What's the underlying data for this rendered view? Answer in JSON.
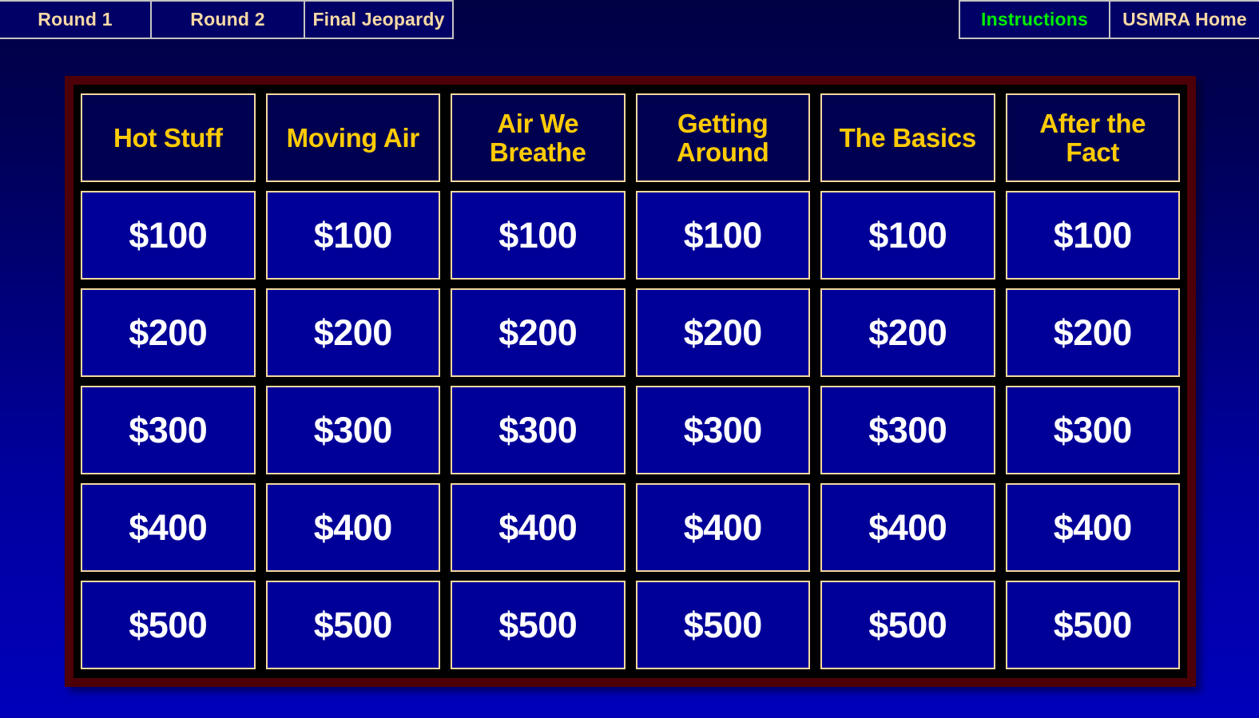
{
  "nav": {
    "left_buttons": [
      {
        "label": "Round 1",
        "name": "nav-round-1"
      },
      {
        "label": "Round 2",
        "name": "nav-round-2"
      },
      {
        "label": "Final Jeopardy",
        "name": "nav-final-jeopardy"
      }
    ],
    "right_buttons": [
      {
        "label": "Instructions",
        "name": "nav-instructions"
      },
      {
        "label": "USMRA Home",
        "name": "nav-usmra-home"
      }
    ]
  },
  "board": {
    "categories": [
      "Hot Stuff",
      "Moving Air",
      "Air We Breathe",
      "Getting Around",
      "The Basics",
      "After the Fact"
    ],
    "values": [
      "$100",
      "$200",
      "$300",
      "$400",
      "$500"
    ],
    "cells": [
      [
        "$100",
        "$100",
        "$100",
        "$100",
        "$100",
        "$100"
      ],
      [
        "$200",
        "$200",
        "$200",
        "$200",
        "$200",
        "$200"
      ],
      [
        "$300",
        "$300",
        "$300",
        "$300",
        "$300",
        "$300"
      ],
      [
        "$400",
        "$400",
        "$400",
        "$400",
        "$400",
        "$400"
      ],
      [
        "$500",
        "$500",
        "$500",
        "$500",
        "$500",
        "$500"
      ]
    ]
  },
  "colors": {
    "page_background_top": "#000044",
    "page_background_bottom": "#0000bb",
    "nav_button_fill": "#000066",
    "nav_button_border": "#c4c4c4",
    "nav_text": "#f7d9a5",
    "nav_instructions_text": "#00ee00",
    "board_frame": "#4d0007",
    "board_inner": "#000000",
    "category_fill": "#000050",
    "category_text": "#ffcb05",
    "cell_border": "#f5d89f",
    "value_fill": "#000099",
    "value_text": "#ffffff"
  }
}
